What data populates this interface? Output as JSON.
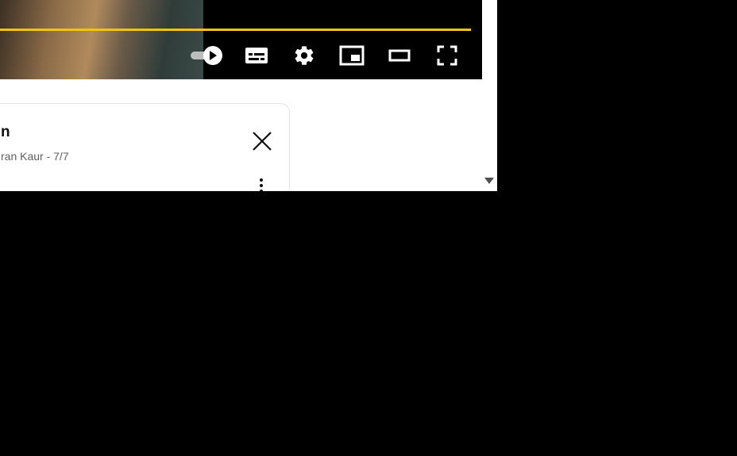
{
  "player": {
    "progress_color": "#f1c40f",
    "controls": [
      {
        "name": "autoplay-toggle",
        "icon": "autoplay-toggle-icon"
      },
      {
        "name": "subtitles-button",
        "icon": "subtitles-icon"
      },
      {
        "name": "settings-button",
        "icon": "gear-icon"
      },
      {
        "name": "miniplayer-button",
        "icon": "miniplayer-icon"
      },
      {
        "name": "theater-mode-button",
        "icon": "theater-mode-icon"
      },
      {
        "name": "fullscreen-button",
        "icon": "fullscreen-icon"
      }
    ]
  },
  "playlist_card": {
    "title": "n",
    "subtitle": "ran Kaur - 7/7",
    "close_icon": "close-icon",
    "menu_icon": "kebab-menu-icon"
  },
  "scrollbar": {
    "down_arrow_icon": "chevron-down-icon"
  }
}
